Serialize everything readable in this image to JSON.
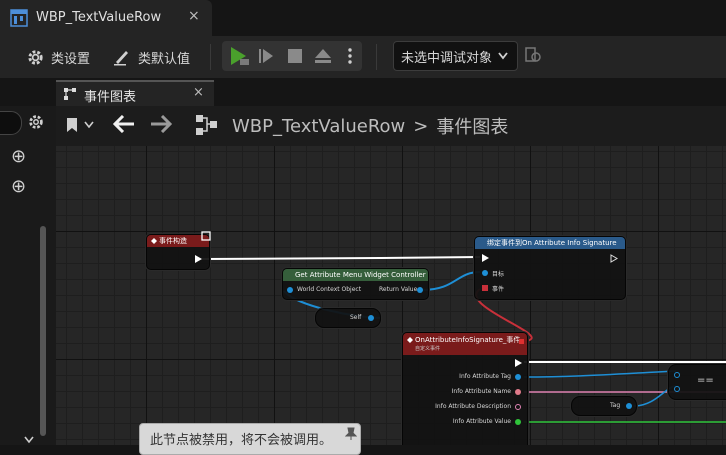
{
  "window": {
    "tab_title": "WBP_TextValueRow",
    "close_glyph": "×"
  },
  "toolbar": {
    "class_settings": "类设置",
    "class_defaults": "类默认值",
    "debug_select": "未选中调试对象",
    "icons": [
      "gear-icon",
      "pen-icon",
      "play-icon",
      "step-icon",
      "stop-icon",
      "eject-icon",
      "more-icon",
      "debug-filter-icon"
    ]
  },
  "graph_tab": {
    "label": "事件图表",
    "close_glyph": "×"
  },
  "breadcrumb": {
    "asset": "WBP_TextValueRow",
    "separator": ">",
    "graph": "事件图表"
  },
  "left_panel": {
    "add_glyph": "⊕"
  },
  "nodes": {
    "event_construct": {
      "title": "事件构造"
    },
    "get_controller": {
      "title": "Get Attribute Menu Widget Controller",
      "in_pin": "World Context Object",
      "out_pin": "Return Value"
    },
    "self_node": {
      "label": "Self"
    },
    "bind_event": {
      "title": "绑定事件到On Attribute Info Signature",
      "target": "目标",
      "event": "事件"
    },
    "custom_event": {
      "title": "OnAttributeInfoSignature_事件",
      "subtitle": "自定义事件",
      "pins": [
        "Info Attribute Tag",
        "Info Attribute Name",
        "Info Attribute Description",
        "Info Attribute Value"
      ]
    },
    "tag_node": {
      "label": "Tag"
    },
    "equal_node": {
      "label": "=="
    }
  },
  "disabled_note": "此节点被禁用，将不会被调用。",
  "colors": {
    "exec": "#ffffff",
    "object": "#1e8fd6",
    "tag": "#e07a8a",
    "bool": "#a11",
    "text": "#e083b4",
    "value": "#2fc43a",
    "event_red": "#c8303a"
  }
}
